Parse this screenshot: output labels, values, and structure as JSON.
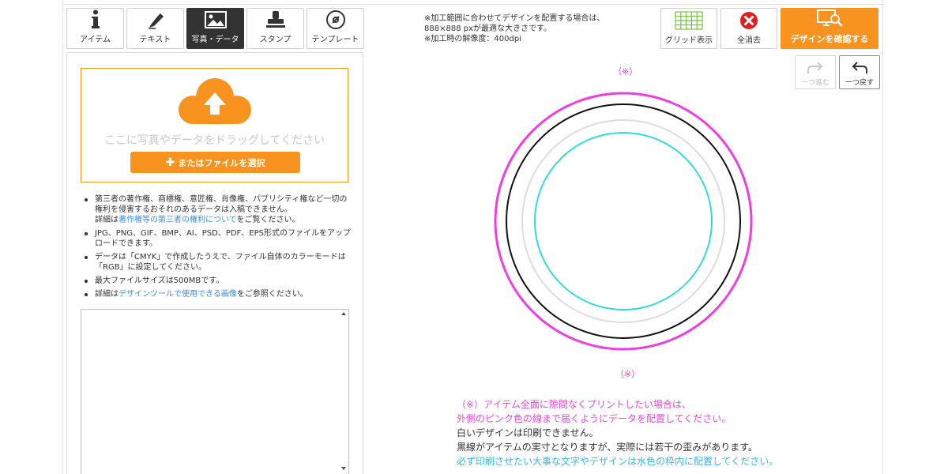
{
  "tabs": [
    {
      "label": "アイテム",
      "icon": "info-icon"
    },
    {
      "label": "テキスト",
      "icon": "pen-icon"
    },
    {
      "label": "写真・データ",
      "icon": "image-icon",
      "active": true
    },
    {
      "label": "スタンプ",
      "icon": "stamp-icon"
    },
    {
      "label": "テンプレート",
      "icon": "disc-icon"
    }
  ],
  "upload": {
    "drop_text": "ここに写真やデータをドラッグしてください",
    "button_label": "またはファイルを選択"
  },
  "notes": {
    "n1a": "第三者の著作権、商標権、意匠権、肖像権、パブリシティ権など一切の権利を侵害するおそれのあるデータは入稿できません。",
    "n1b": "詳細は",
    "n1link": "著作権等の第三者の権利について",
    "n1c": "をご覧ください。",
    "n2": "JPG、PNG、GIF、BMP、AI、PSD、PDF、EPS形式のファイルをアップロードできます。",
    "n3": "データは「CMYK」で作成したうえで、ファイル自体のカラーモードは「RGB」に設定してください。",
    "n4": "最大ファイルサイズは500MBです。",
    "n5a": "詳細は",
    "n5link": "デザインツールで使用できる画像",
    "n5b": "をご参照ください。"
  },
  "header_info": {
    "line1": "※加工範囲に合わせてデザインを配置する場合は、",
    "line2": "888×888 pxが最適な大きさです。",
    "line3": "※加工時の解像度：400dpi"
  },
  "toolbar": {
    "grid_label": "グリッド表示",
    "clear_label": "全消去",
    "confirm_label": "デザインを確認する",
    "redo_label": "一つ進む",
    "undo_label": "一つ戻す"
  },
  "canvas": {
    "mark_top": "（※）",
    "mark_bottom": "（※）",
    "colors": {
      "pink": "#ee3de3",
      "black": "#111111",
      "gray": "#dddddd",
      "cyan": "#33d9e0"
    }
  },
  "bottom_notes": {
    "pink1": "（※）アイテム全面に隙間なくプリントしたい場合は、",
    "pink2": "外側のピンク色の線まで届くようにデータを配置してください。",
    "dark1": "白いデザインは印刷できません。",
    "dark2": "黒線がアイテムの実寸となりますが、実際には若干の歪みがあります。",
    "cyan1": "必ず印刷させたい大事な文字やデザインは水色の枠内に配置してください。"
  }
}
